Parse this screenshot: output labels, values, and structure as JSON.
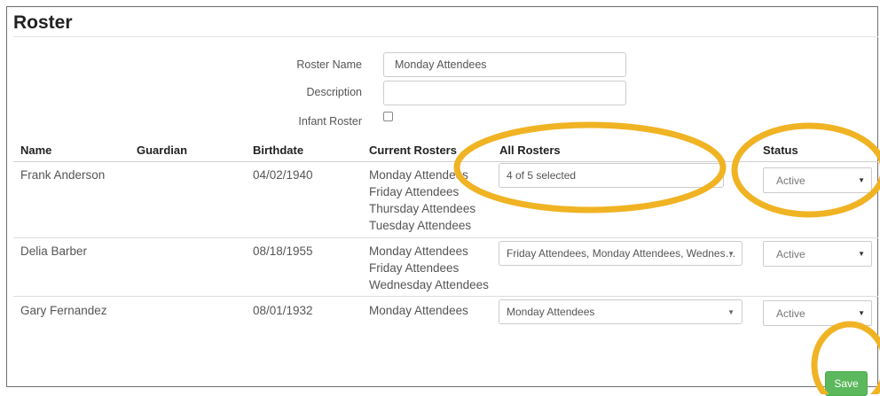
{
  "page": {
    "title": "Roster"
  },
  "form": {
    "roster_name_label": "Roster Name",
    "roster_name_value": "Monday Attendees",
    "description_label": "Description",
    "description_value": "",
    "infant_label": "Infant Roster",
    "infant_checked": false
  },
  "table": {
    "headers": [
      "Name",
      "Guardian",
      "Birthdate",
      "Current Rosters",
      "All Rosters",
      "Status"
    ],
    "rows": [
      {
        "name": "Frank Anderson",
        "guardian": "",
        "birthdate": "04/02/1940",
        "current": [
          "Monday Attendees",
          "Friday Attendees",
          "Thursday Attendees",
          "Tuesday Attendees"
        ],
        "all_rosters": "4 of 5 selected",
        "status": "Active"
      },
      {
        "name": "Delia Barber",
        "guardian": "",
        "birthdate": "08/18/1955",
        "current": [
          "Monday Attendees",
          "Friday Attendees",
          "Wednesday Attendees"
        ],
        "all_rosters": "Friday Attendees, Monday Attendees, Wednes…",
        "status": "Active"
      },
      {
        "name": "Gary Fernandez",
        "guardian": "",
        "birthdate": "08/01/1932",
        "current": [
          "Monday Attendees"
        ],
        "all_rosters": "Monday Attendees",
        "status": "Active"
      }
    ]
  },
  "actions": {
    "save_label": "Save"
  },
  "icons": {
    "caret": "caret-down-icon",
    "checkbox": "checkbox-icon"
  },
  "colors": {
    "save_button": "#5cb85c",
    "annotation": "#f0b323"
  }
}
